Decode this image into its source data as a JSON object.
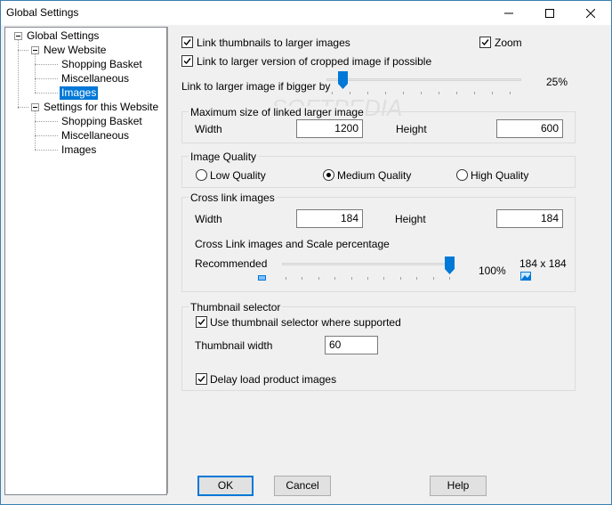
{
  "window": {
    "title": "Global Settings"
  },
  "tree": {
    "root": "Global Settings",
    "new_website": "New Website",
    "nw_items": [
      "Shopping Basket",
      "Miscellaneous",
      "Images"
    ],
    "this_website": "Settings for this Website",
    "tw_items": [
      "Shopping Basket",
      "Miscellaneous",
      "Images"
    ]
  },
  "options": {
    "link_thumbnails": "Link thumbnails to larger images",
    "link_thumbnails_checked": true,
    "zoom": "Zoom",
    "zoom_checked": true,
    "link_cropped": "Link to larger version of cropped image if possible",
    "link_cropped_checked": true,
    "link_if_bigger": "Link to larger image if bigger by",
    "link_if_bigger_value": "25%",
    "link_if_bigger_fraction": 0.25
  },
  "max_size": {
    "title": "Maximum size of linked larger image",
    "width_label": "Width",
    "width_value": "1200",
    "height_label": "Height",
    "height_value": "600"
  },
  "quality": {
    "title": "Image Quality",
    "low": "Low Quality",
    "medium": "Medium Quality",
    "high": "High Quality",
    "selected": "medium"
  },
  "cross_link": {
    "title": "Cross link images",
    "width_label": "Width",
    "width_value": "184",
    "height_label": "Height",
    "height_value": "184",
    "scale_label": "Cross Link images and Scale percentage",
    "recommended": "Recommended",
    "scale_value": "100%",
    "scale_fraction": 1.0,
    "size_readout": "184 x 184"
  },
  "thumb_selector": {
    "title": "Thumbnail selector",
    "use_selector": "Use thumbnail selector where supported",
    "use_selector_checked": true,
    "width_label": "Thumbnail width",
    "width_value": "60",
    "delay_load": "Delay load product images",
    "delay_load_checked": true
  },
  "buttons": {
    "ok": "OK",
    "cancel": "Cancel",
    "help": "Help"
  },
  "colors": {
    "accent": "#0078d7",
    "selection": "#0078d7"
  }
}
